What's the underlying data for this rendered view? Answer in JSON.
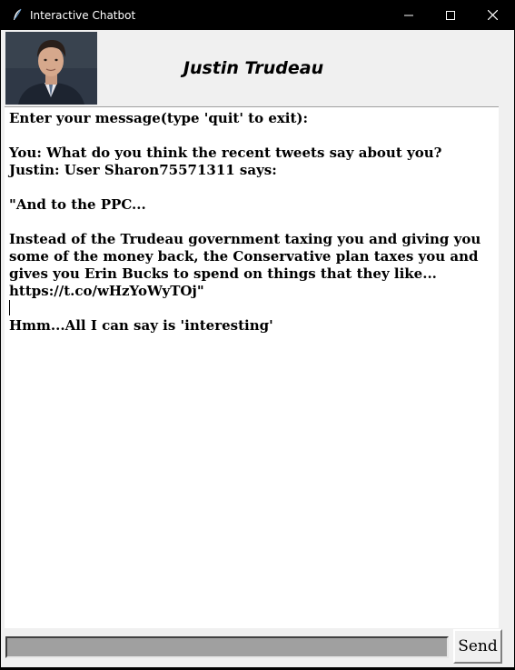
{
  "window": {
    "title": "Interactive Chatbot",
    "icon": "feather-icon"
  },
  "header": {
    "contact_name": "Justin Trudeau",
    "avatar": "profile-photo"
  },
  "chat": {
    "lines": [
      "Enter your message(type 'quit' to exit):",
      "",
      "You: What do you think the recent tweets say about you?",
      "Justin: User Sharon75571311 says:",
      "",
      "\"And to the PPC...",
      "",
      "Instead of the Trudeau government taxing you and giving you some of the money back, the Conservative plan taxes you and gives you Erin Bucks to spend on things that they like... https://t.co/wHzYoWyTOj\"",
      "",
      "Hmm...All I can say is 'interesting'"
    ]
  },
  "input": {
    "value": "",
    "send_label": "Send"
  },
  "colors": {
    "titlebar": "#000000",
    "window_bg": "#f0f0f0",
    "chat_bg": "#ffffff",
    "input_bg": "#a0a0a0"
  }
}
